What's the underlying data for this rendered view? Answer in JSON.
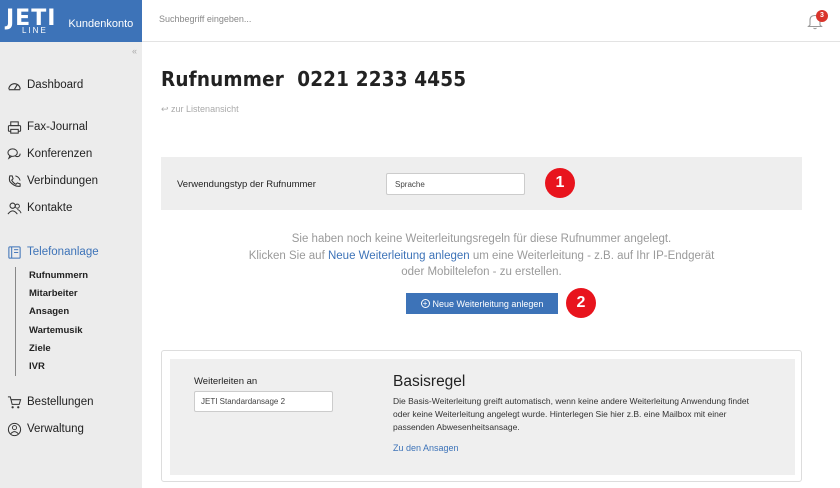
{
  "brand": {
    "logo_text": "JETI",
    "logo_sub": "LINE",
    "label": "Kundenkonto"
  },
  "header": {
    "search_placeholder": "Suchbegriff eingeben...",
    "notification_count": "3"
  },
  "sidebar": {
    "collapse_glyph": "«",
    "items": [
      {
        "label": "Dashboard",
        "icon": "gauge-icon"
      },
      {
        "label": "Fax-Journal",
        "icon": "printer-icon"
      },
      {
        "label": "Konferenzen",
        "icon": "chat-bubbles-icon"
      },
      {
        "label": "Verbindungen",
        "icon": "phone-call-icon"
      },
      {
        "label": "Kontakte",
        "icon": "contacts-icon"
      },
      {
        "label": "Telefonanlage",
        "icon": "pbx-icon",
        "active": true
      },
      {
        "label": "Bestellungen",
        "icon": "cart-icon"
      },
      {
        "label": "Verwaltung",
        "icon": "user-circle-icon"
      }
    ],
    "subitems": [
      "Rufnummern",
      "Mitarbeiter",
      "Ansagen",
      "Wartemusik",
      "Ziele",
      "IVR"
    ]
  },
  "page": {
    "title": "Rufnummer  0221 2233 4455",
    "back_link": "zur Listenansicht"
  },
  "usage_type": {
    "label": "Verwendungstyp der Rufnummer",
    "value": "Sprache"
  },
  "markers": [
    "1",
    "2"
  ],
  "empty_state": {
    "line1": "Sie haben noch keine Weiterleitungsregeln für diese Rufnummer angelegt.",
    "line2_prefix": "Klicken Sie auf ",
    "line2_link": "Neue Weiterleitung anlegen",
    "line2_suffix": " um eine Weiterleitung - z.B. auf Ihr IP-Endgerät",
    "line3": "oder Mobiltelefon - zu erstellen.",
    "button_label": "Neue Weiterleitung anlegen"
  },
  "basic_rule": {
    "forward_label": "Weiterleiten an",
    "forward_value": "JETI Standardansage 2",
    "title": "Basisregel",
    "description": "Die Basis-Weiterleitung greift automatisch, wenn keine andere Weiterleitung Anwendung findet oder keine Weiterleitung angelegt wurde. Hinterlegen Sie hier z.B. eine Mailbox mit einer passenden Abwesenheitsansage.",
    "link": "Zu den Ansagen"
  },
  "colors": {
    "brand_blue": "#3d73b8",
    "marker_red": "#e8141d",
    "sidebar_bg": "#ececec",
    "panel_bg": "#eeeeee"
  }
}
